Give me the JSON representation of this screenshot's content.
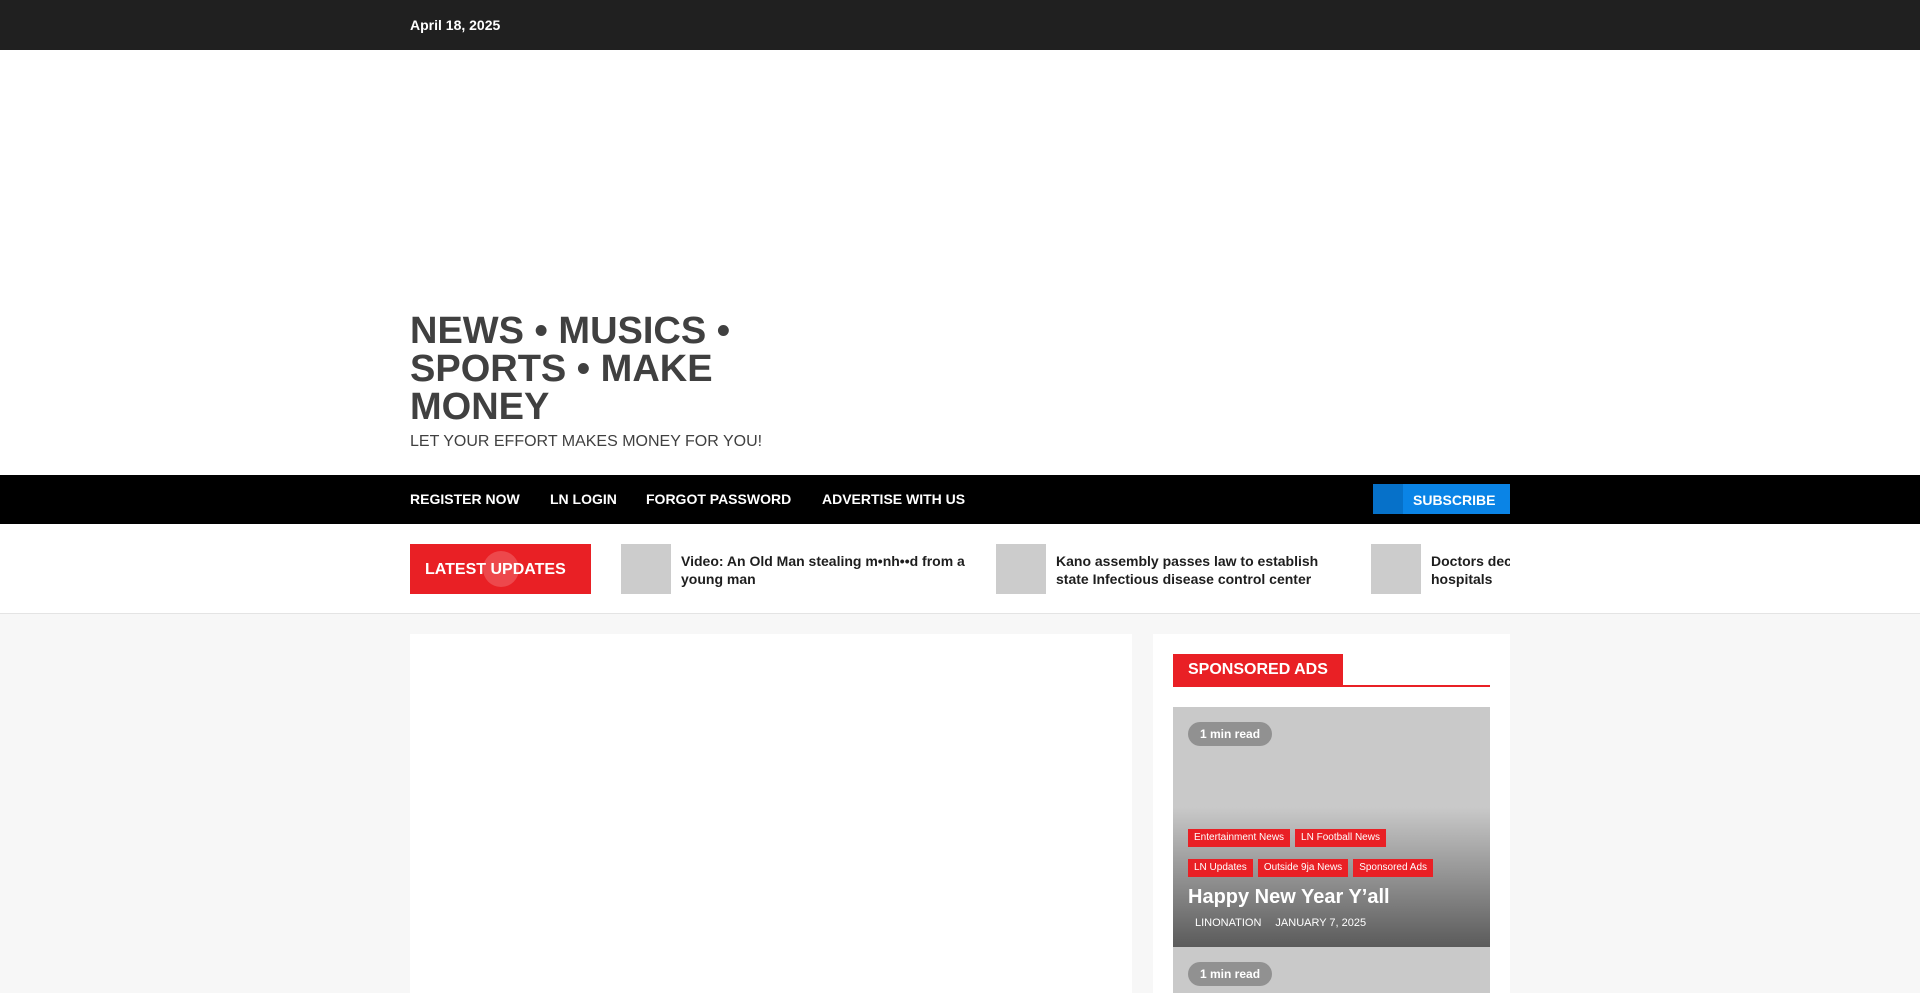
{
  "topbar": {
    "date": "April 18, 2025"
  },
  "site": {
    "title": "NEWS • MUSICS • SPORTS • MAKE MONEY",
    "tagline": "LET YOUR EFFORT MAKES MONEY FOR YOU!"
  },
  "nav": {
    "items": [
      {
        "label": "REGISTER NOW"
      },
      {
        "label": "LN LOGIN"
      },
      {
        "label": "FORGOT PASSWORD"
      },
      {
        "label": "ADVERTISE WITH US"
      }
    ],
    "subscribe_label": "SUBSCRIBE"
  },
  "ticker": {
    "label": "LATEST UPDATES",
    "items": [
      {
        "title": "Video: An Old Man stealing m•nh••d from a young man"
      },
      {
        "title": "Kano assembly passes law to establish state Infectious disease control center"
      },
      {
        "title": "Doctors declare strike in Abuja, shut down hospitals"
      }
    ]
  },
  "sidebar": {
    "widget_title": "SPONSORED ADS",
    "posts": [
      {
        "read_time": "1 min read",
        "categories": [
          "Entertainment News",
          "LN Football News",
          "LN Updates",
          "Outside 9ja News",
          "Sponsored Ads"
        ],
        "title": "Happy New Year Y’all",
        "author": "LINONATION",
        "date": "JANUARY 7, 2025"
      },
      {
        "read_time": "1 min read"
      }
    ]
  },
  "colors": {
    "accent_red": "#e92025",
    "subscribe_blue": "#0a84e6",
    "topbar": "#202020",
    "navbar": "#000000"
  }
}
